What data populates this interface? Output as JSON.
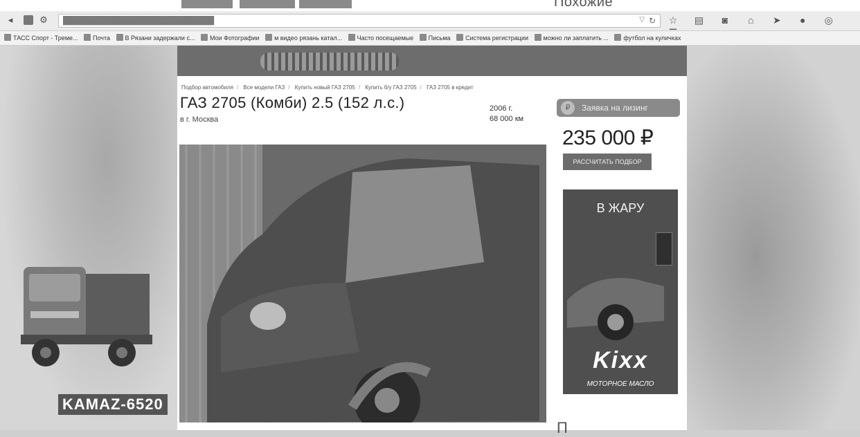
{
  "top": {
    "similar_label": "Похожие"
  },
  "browser": {
    "url_hint": "",
    "bookmarks": [
      "ТАСС Спорт - Треме...",
      "Почта",
      "В Рязани задержали с...",
      "Мои Фотографии",
      "м видео рязань катал...",
      "Часто посещаемые",
      "Письма",
      "Система регистрации",
      "можно ли заплатить ...",
      "футбол на куличках"
    ]
  },
  "left_banner": {
    "label": "KAMAZ-6520"
  },
  "listing": {
    "breadcrumb": [
      "Подбор автомобиля",
      "Все модели ГАЗ",
      "Купить новый ГАЗ 2705",
      "Купить б/у ГАЗ 2705",
      "ГАЗ 2705 в кредит"
    ],
    "title": "ГАЗ 2705 (Комби) 2.5 (152 л.с.)",
    "city": "в г. Москва",
    "year": "2006 г.",
    "mileage": "68 000 км"
  },
  "sidebar": {
    "leasing_label": "Заявка на лизинг",
    "price": "235 000 ₽",
    "calc_label": "Рассчитать подбор",
    "ad": {
      "headline": "В ЖАРУ",
      "brand": "Kixx",
      "tagline": "МОТОРНОЕ МАСЛО"
    },
    "similar_label": "П"
  }
}
